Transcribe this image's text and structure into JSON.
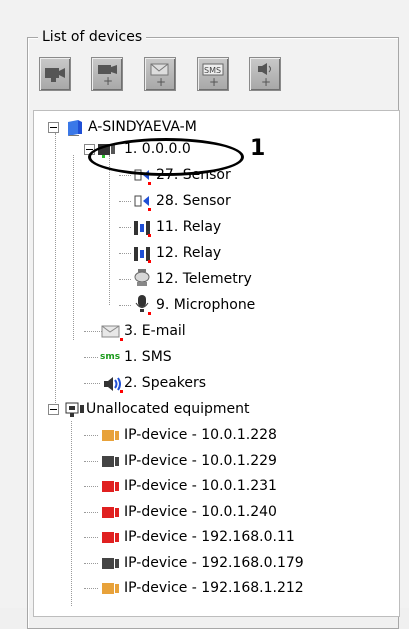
{
  "panel": {
    "title": "List of devices"
  },
  "toolbar": {
    "buttons": [
      {
        "name": "camera"
      },
      {
        "name": "add-camera"
      },
      {
        "name": "add-email"
      },
      {
        "name": "add-sms"
      },
      {
        "name": "add-speaker"
      }
    ],
    "sms_label": "SMS",
    "plus": "+"
  },
  "tree": {
    "server": "A-SINDYAEVA-M",
    "device": "1. 0.0.0.0",
    "children": [
      "27. Sensor",
      "28. Sensor",
      "11. Relay",
      "12. Relay",
      "12. Telemetry",
      "9. Microphone"
    ],
    "notifiers": [
      "3. E-mail",
      "1. SMS",
      "2. Speakers"
    ],
    "sms_tag": "sms",
    "unallocated": "Unallocated equipment",
    "ip_devices": [
      "IP-device - 10.0.1.228",
      "IP-device - 10.0.1.229",
      "IP-device - 10.0.1.231",
      "IP-device - 10.0.1.240",
      "IP-device - 192.168.0.11",
      "IP-device - 192.168.0.179",
      "IP-device - 192.168.1.212"
    ]
  },
  "annotation": {
    "number": "1"
  },
  "colors": {
    "accent_red": "#ff0000",
    "blue": "#1f4fd6"
  }
}
